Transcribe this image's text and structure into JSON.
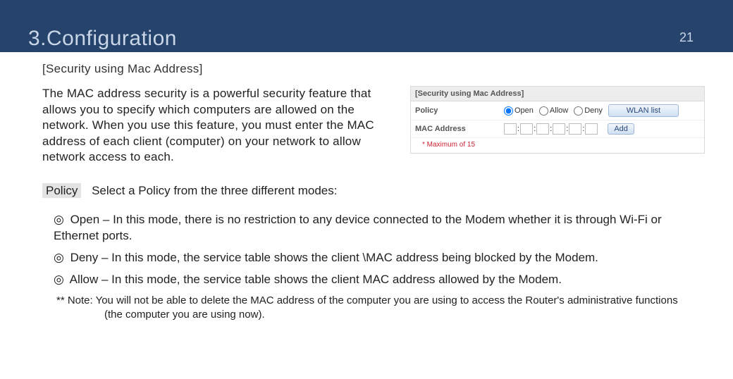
{
  "header": {
    "title": "3.Configuration",
    "page": "21"
  },
  "section": "[Security using Mac Address]",
  "intro": "The MAC address security is a powerful security feature that allows you to specify which computers are allowed on the network. When you use this feature, you must enter the MAC address of each client (computer) on your network to allow network access to each.",
  "panel": {
    "title": "[Security using Mac Address]",
    "policy_label": "Policy",
    "mac_label": "MAC Address",
    "radios": {
      "open": "Open",
      "allow": "Allow",
      "deny": "Deny"
    },
    "selected_policy": "open",
    "wlan_btn": "WLAN list",
    "add_btn": "Add",
    "note": "* Maximum of 15"
  },
  "policy": {
    "chip": "Policy",
    "text": "Select a Policy from the three different modes:"
  },
  "modes": {
    "open": "Open – In this mode, there is no restriction to any device connected to the Modem whether it is through Wi-Fi or Ethernet ports.",
    "deny": "Deny – In this mode, the service table shows the client \\MAC address being blocked by the Modem.",
    "allow": "Allow – In this mode, the service table shows the client MAC address allowed by the Modem."
  },
  "note": "** Note: You will not be able to delete the MAC address of the computer you are using to access the Router's administrative functions",
  "note_cont": "(the computer you are using now).",
  "bullet": "◎"
}
